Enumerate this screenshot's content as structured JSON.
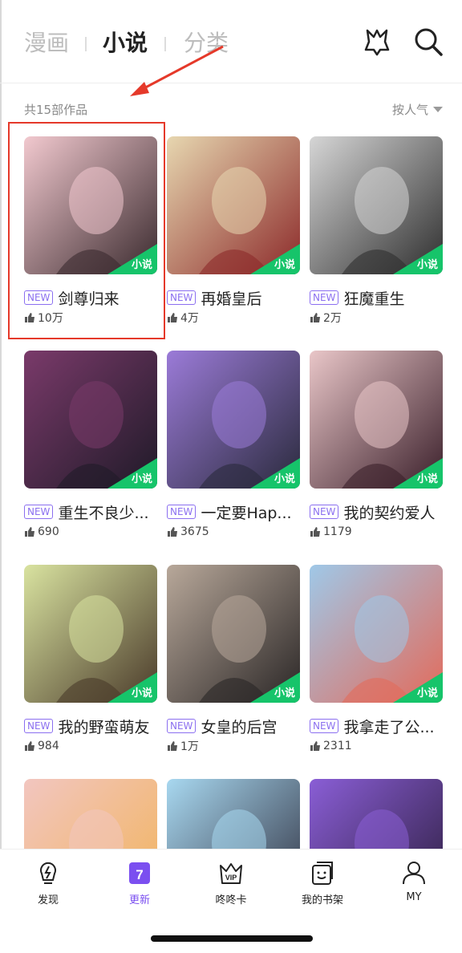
{
  "tabs": [
    {
      "label": "漫画",
      "active": false
    },
    {
      "label": "小说",
      "active": true
    },
    {
      "label": "分类",
      "active": false
    }
  ],
  "header_icons": [
    "badge-icon",
    "search-icon"
  ],
  "list_header": {
    "count": "共15部作品",
    "sort": "按人气"
  },
  "cards": [
    {
      "new": "NEW",
      "title": "剑尊归来",
      "likes": "10万",
      "tag": "小说",
      "colors": [
        "#f2c9cf",
        "#3a2a2e"
      ]
    },
    {
      "new": "NEW",
      "title": "再婚皇后",
      "likes": "4万",
      "tag": "小说",
      "colors": [
        "#e7d7b0",
        "#8c2a2a"
      ]
    },
    {
      "new": "NEW",
      "title": "狂魔重生",
      "likes": "2万",
      "tag": "小说",
      "colors": [
        "#d6d6d6",
        "#2e2e2e"
      ]
    },
    {
      "new": "NEW",
      "title": "重生不良少...",
      "likes": "690",
      "tag": "小说",
      "colors": [
        "#7a3a6a",
        "#1f1a28"
      ]
    },
    {
      "new": "NEW",
      "title": "一定要Hap...",
      "likes": "3675",
      "tag": "小说",
      "colors": [
        "#9b7bd8",
        "#2a2a3c"
      ]
    },
    {
      "new": "NEW",
      "title": "我的契约爱人",
      "likes": "1179",
      "tag": "小说",
      "colors": [
        "#e9c6c8",
        "#3a1f2a"
      ]
    },
    {
      "new": "NEW",
      "title": "我的野蛮萌友",
      "likes": "984",
      "tag": "小说",
      "colors": [
        "#d9e3a0",
        "#4a3a2a"
      ]
    },
    {
      "new": "NEW",
      "title": "女皇的后宫",
      "likes": "1万",
      "tag": "小说",
      "colors": [
        "#b8a89a",
        "#2a2626"
      ]
    },
    {
      "new": "NEW",
      "title": "我拿走了公...",
      "likes": "2311",
      "tag": "小说",
      "colors": [
        "#9fc8e8",
        "#e36a5a"
      ]
    },
    {
      "colors": [
        "#f2c6c0",
        "#f1b35a"
      ]
    },
    {
      "colors": [
        "#a8d8f0",
        "#2d2d3d"
      ]
    },
    {
      "colors": [
        "#8a5ed6",
        "#2a1c3a"
      ]
    }
  ],
  "bottom_nav": [
    {
      "label": "发现",
      "icon": "lightning-icon",
      "active": false
    },
    {
      "label": "更新",
      "icon": "calendar-icon",
      "active": true,
      "badge": "7"
    },
    {
      "label": "咚咚卡",
      "icon": "vip-crown-icon",
      "active": false
    },
    {
      "label": "我的书架",
      "icon": "bookshelf-icon",
      "active": false
    },
    {
      "label": "MY",
      "icon": "user-icon",
      "active": false
    }
  ],
  "accent": "#7b4ff0",
  "tag_color": "#16c46a",
  "annotation_color": "#e5392a"
}
